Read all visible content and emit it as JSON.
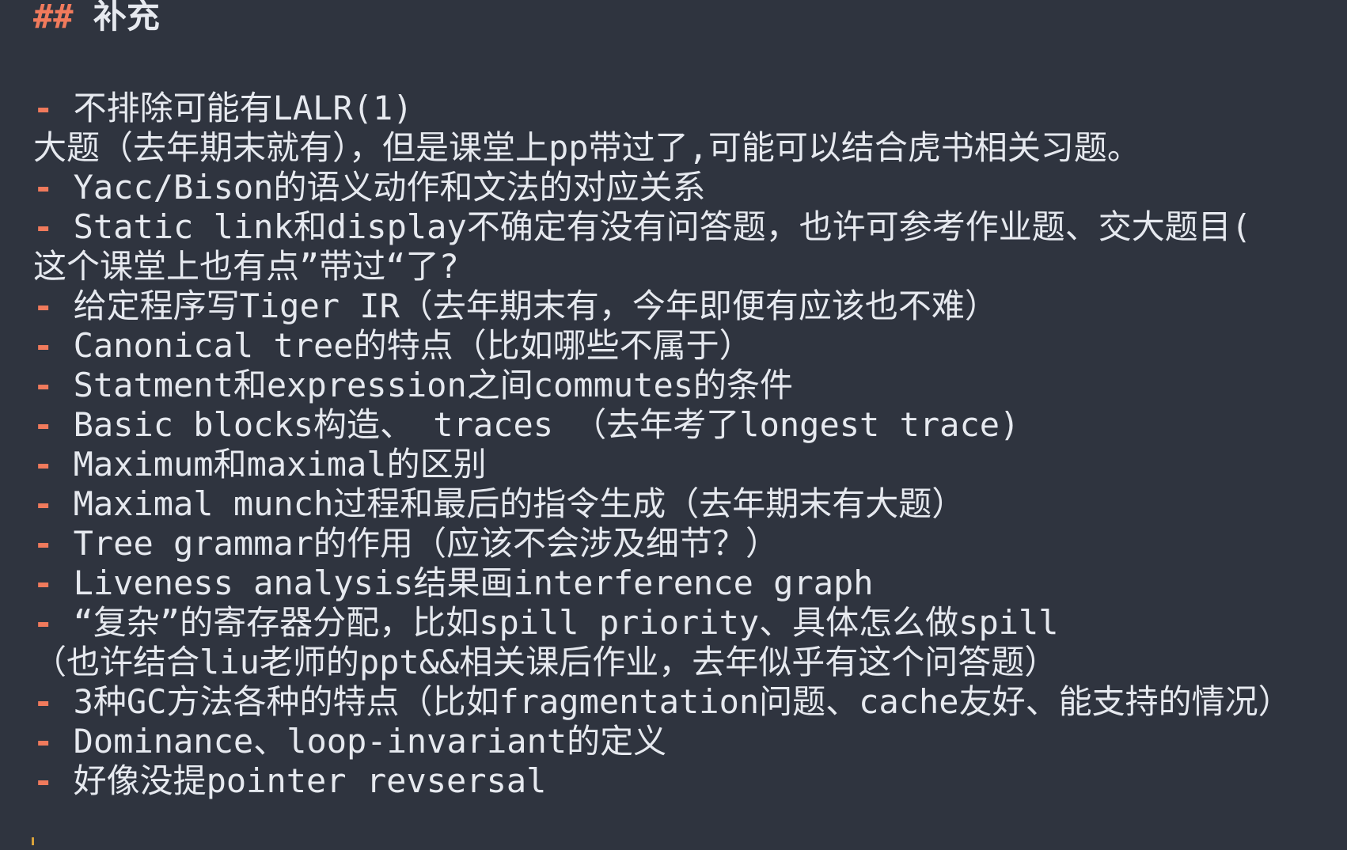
{
  "heading": {
    "marker": "##",
    "text": " 补充"
  },
  "lines": [
    {
      "bullet": "-",
      "text": " 不排除可能有LALR(1)"
    },
    {
      "bullet": "",
      "text": "大题（去年期末就有），但是课堂上pp带过了,可能可以结合虎书相关习题。"
    },
    {
      "bullet": "-",
      "text": " Yacc/Bison的语义动作和文法的对应关系"
    },
    {
      "bullet": "-",
      "text": " Static link和display不确定有没有问答题，也许可参考作业题、交大题目("
    },
    {
      "bullet": "",
      "text": "这个课堂上也有点”带过“了?"
    },
    {
      "bullet": "-",
      "text": " 给定程序写Tiger IR（去年期末有，今年即便有应该也不难）"
    },
    {
      "bullet": "-",
      "text": " Canonical tree的特点（比如哪些不属于）"
    },
    {
      "bullet": "-",
      "text": " Statment和expression之间commutes的条件"
    },
    {
      "bullet": "-",
      "text": " Basic blocks构造、 traces （去年考了longest trace)"
    },
    {
      "bullet": "-",
      "text": " Maximum和maximal的区别"
    },
    {
      "bullet": "-",
      "text": " Maximal munch过程和最后的指令生成（去年期末有大题）"
    },
    {
      "bullet": "-",
      "text": " Tree grammar的作用（应该不会涉及细节？）"
    },
    {
      "bullet": "-",
      "text": " Liveness analysis结果画interference graph"
    },
    {
      "bullet": "-",
      "text": " “复杂”的寄存器分配，比如spill priority、具体怎么做spill"
    },
    {
      "bullet": "",
      "text": "（也许结合liu老师的ppt&&相关课后作业，去年似乎有这个问答题）"
    },
    {
      "bullet": "-",
      "text": " 3种GC方法各种的特点（比如fragmentation问题、cache友好、能支持的情况）"
    },
    {
      "bullet": "-",
      "text": " Dominance、loop-invariant的定义"
    },
    {
      "bullet": "-",
      "text": " 好像没提pointer revsersal"
    }
  ],
  "colors": {
    "background": "#2f343f",
    "text": "#e6e9ef",
    "accent": "#f07a5c",
    "cursor": "#d8a23a"
  }
}
